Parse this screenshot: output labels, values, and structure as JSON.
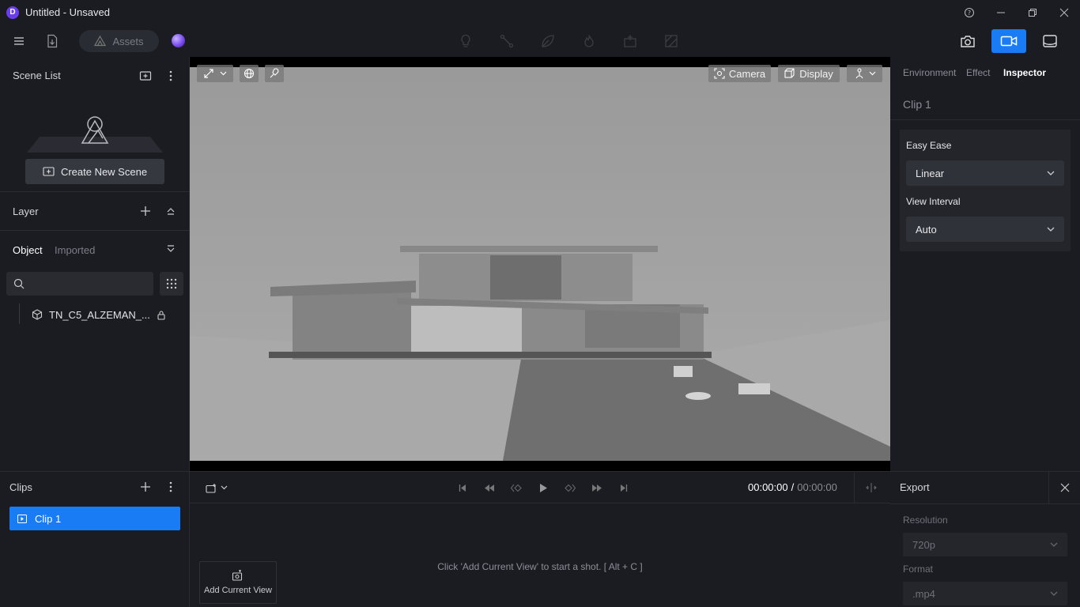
{
  "window": {
    "title": "Untitled - Unsaved",
    "logo_letter": "D"
  },
  "toolbar": {
    "assets_label": "Assets"
  },
  "scene_list": {
    "title": "Scene List",
    "create_label": "Create New Scene"
  },
  "layer": {
    "title": "Layer"
  },
  "objects": {
    "tabs": [
      "Object",
      "Imported"
    ],
    "search_placeholder": "",
    "items": [
      {
        "name": "TN_C5_ALZEMAN_...",
        "locked": true
      }
    ]
  },
  "viewport": {
    "camera_label": "Camera",
    "display_label": "Display"
  },
  "right_panel": {
    "tabs": [
      "Environment",
      "Effect",
      "Inspector"
    ],
    "active_tab": "Inspector",
    "clip_title": "Clip 1",
    "easy_ease_label": "Easy Ease",
    "easy_ease_value": "Linear",
    "view_interval_label": "View Interval",
    "view_interval_value": "Auto"
  },
  "clips": {
    "title": "Clips",
    "items": [
      "Clip 1"
    ]
  },
  "timeline": {
    "current_time": "00:00:00",
    "separator": "/",
    "total_time": "00:00:00",
    "hint": "Click 'Add Current View' to start a shot. [ Alt + C ]",
    "add_view_label": "Add Current View"
  },
  "export": {
    "title": "Export",
    "resolution_label": "Resolution",
    "resolution_value": "720p",
    "format_label": "Format",
    "format_value": ".mp4"
  },
  "colors": {
    "accent": "#1a7cf5",
    "background": "#1b1c22",
    "panel": "#23252b"
  }
}
